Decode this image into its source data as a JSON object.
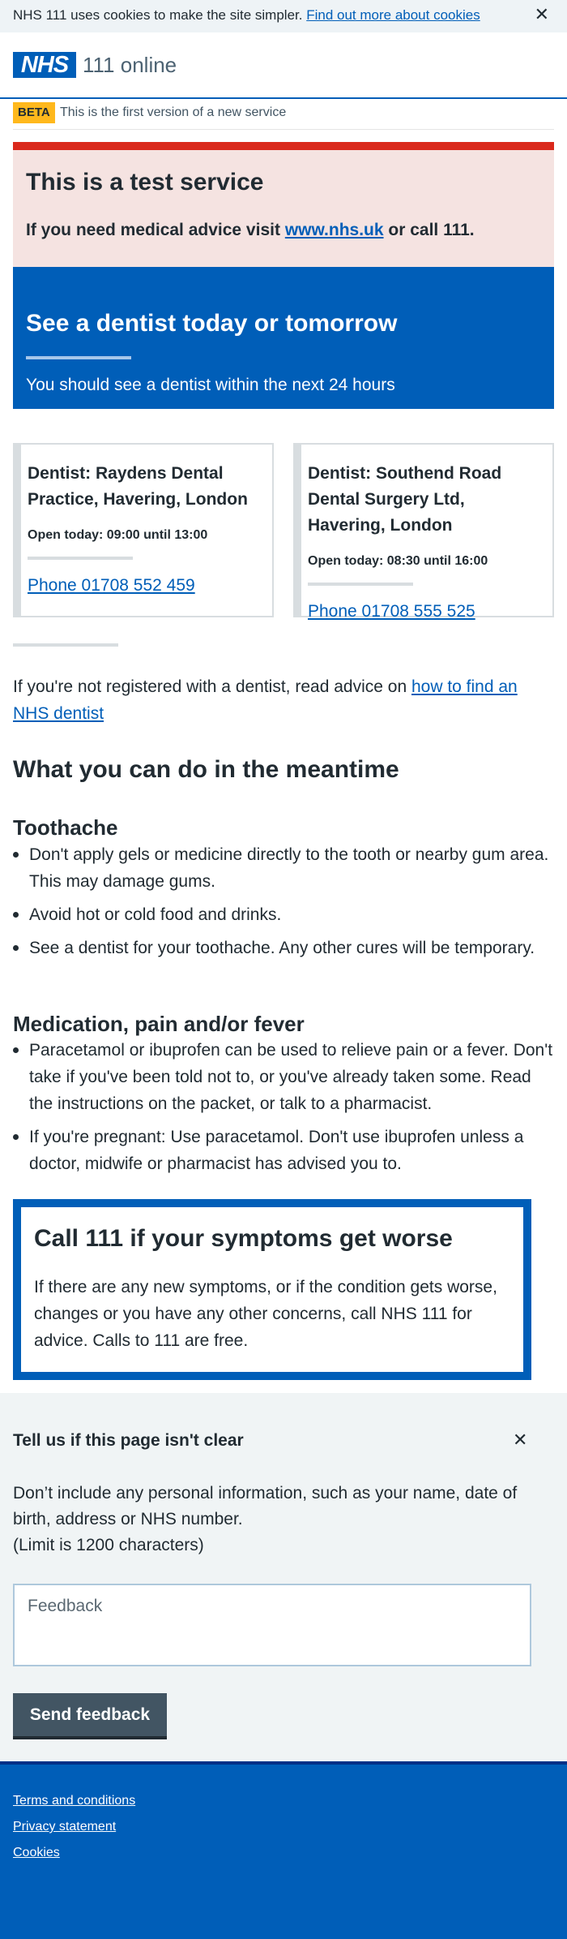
{
  "cookie_banner": {
    "text": "NHS 111 uses cookies to make the site simpler.",
    "link": "Find out more about cookies",
    "close": "✕"
  },
  "header": {
    "logo": "NHS",
    "service_name": "111 online"
  },
  "beta": {
    "tag": "BETA",
    "text": "This is the first version of a new service"
  },
  "test_service": {
    "title": "This is a test service",
    "text_before": "If you need medical advice visit",
    "link": "www.nhs.uk",
    "text_after": "or call 111."
  },
  "care_card": {
    "title": "See a dentist today or tomorrow",
    "subtitle": "You should see a dentist within the next 24 hours"
  },
  "dentists": [
    {
      "name": "Dentist: Raydens Dental Practice, Havering, London",
      "open": "Open today: 09:00 until 13:00",
      "phone": "Phone 01708 552 459"
    },
    {
      "name": "Dentist: Southend Road Dental Surgery Ltd, Havering, London",
      "open": "Open today: 08:30 until 16:00",
      "phone": "Phone 01708 555 525"
    }
  ],
  "registration": {
    "text": "If you're not registered with a dentist, read advice on",
    "link": "how to find an NHS dentist"
  },
  "meantime": {
    "title": "What you can do in the meantime",
    "toothache": {
      "title": "Toothache",
      "items": [
        "Don't apply gels or medicine directly to the tooth or nearby gum area. This may damage gums.",
        "Avoid hot or cold food and drinks.",
        "See a dentist for your toothache. Any other cures will be temporary."
      ]
    },
    "medication": {
      "title": "Medication, pain and/or fever",
      "items": [
        "Paracetamol or ibuprofen can be used to relieve pain or a fever. Don't take if you've been told not to, or you've already taken some. Read the instructions on the packet, or talk to a pharmacist.",
        "If you're pregnant: Use paracetamol. Don't use ibuprofen unless a doctor, midwife or pharmacist has advised you to."
      ]
    }
  },
  "call_111": {
    "title": "Call 111 if your symptoms get worse",
    "text": "If there are any new symptoms, or if the condition gets worse, changes or you have any other concerns, call NHS 111 for advice. Calls to 111 are free."
  },
  "feedback": {
    "title": "Tell us if this page isn't clear",
    "close": "✕",
    "info_1": "Don’t include any personal information, such as your name, date of birth, address or NHS number.",
    "info_2": "(Limit is 1200 characters)",
    "placeholder": "Feedback",
    "button": "Send feedback"
  },
  "footer": {
    "links": [
      "Terms and conditions",
      "Privacy statement",
      "Cookies"
    ]
  },
  "colors": {
    "nhs_blue": "#005eb8",
    "nhs_dark_blue": "#003087",
    "warning_red": "#da291c",
    "beta_yellow": "#ffb81c",
    "text": "#212b32",
    "grey_bg": "#f0f4f5"
  }
}
